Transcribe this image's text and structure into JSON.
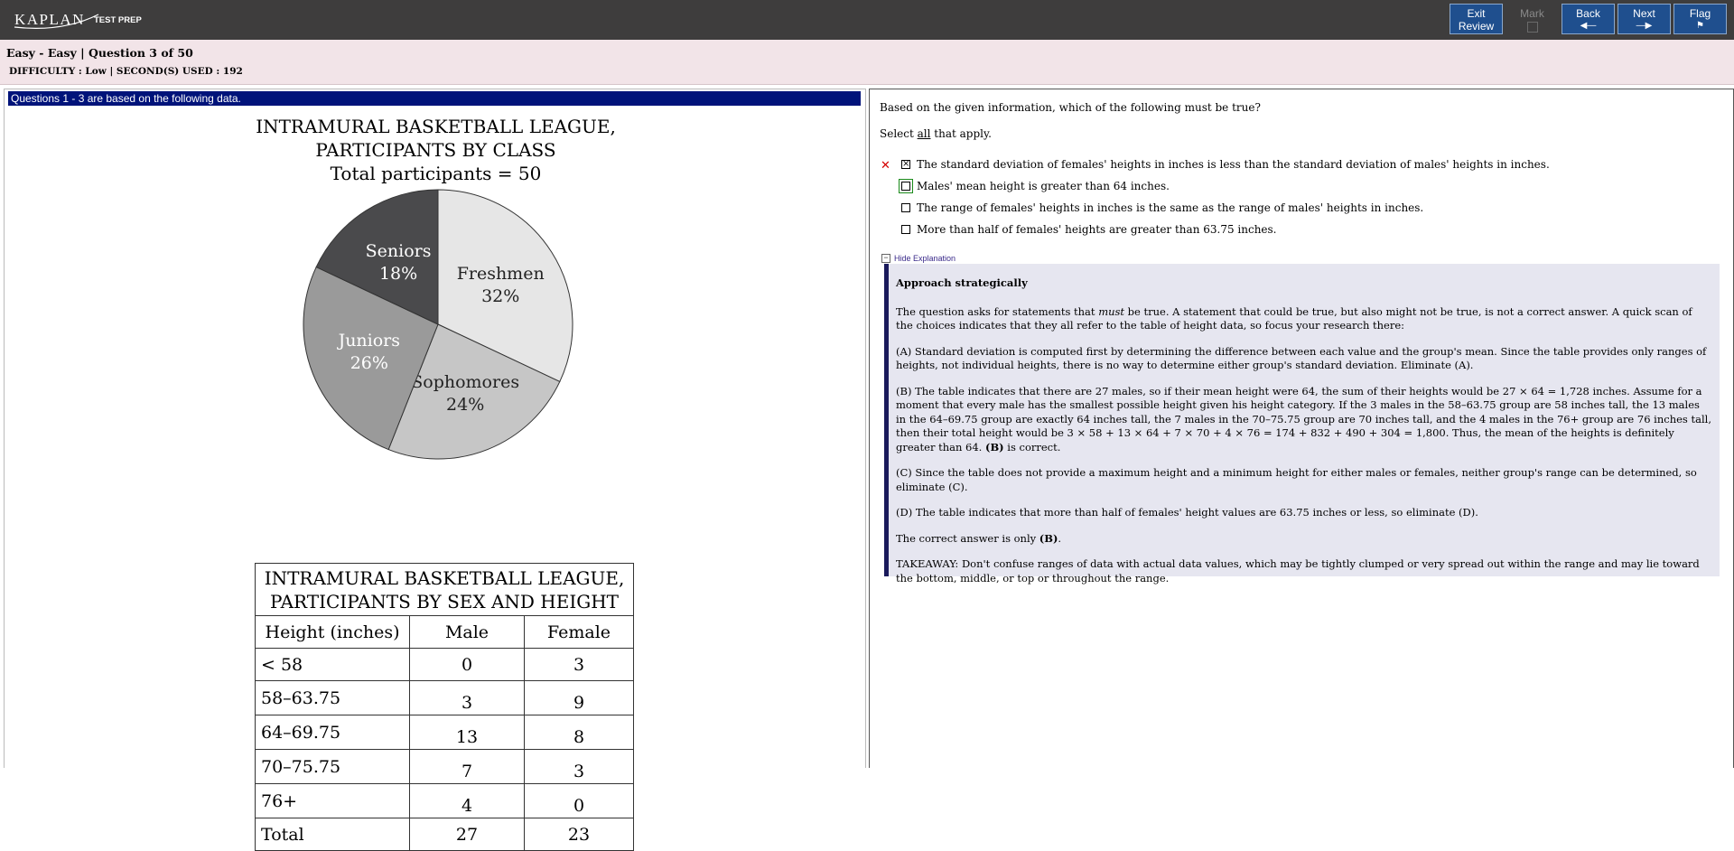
{
  "brand": {
    "name": "KAPLAN",
    "subtitle": "TEST PREP"
  },
  "toolbar": {
    "exit_label": "Exit",
    "exit_sub": "Review",
    "mark_label": "Mark",
    "back_label": "Back",
    "next_label": "Next",
    "flag_label": "Flag"
  },
  "info": {
    "question_line": "Easy - Easy | Question  3 of 50",
    "difficulty_line": "DIFFICULTY : Low | SECOND(S) USED : 192"
  },
  "passage": {
    "header": "Questions 1 - 3 are based on the following data.",
    "pie_title_1": "INTRAMURAL BASKETBALL LEAGUE,",
    "pie_title_2": "PARTICIPANTS BY CLASS",
    "pie_title_3": "Total participants = 50",
    "table_title_1": "INTRAMURAL BASKETBALL LEAGUE,",
    "table_title_2": "PARTICIPANTS BY SEX AND HEIGHT",
    "table_headers": [
      "Height (inches)",
      "Male",
      "Female"
    ],
    "table_rows": [
      [
        "< 58",
        "0",
        "3"
      ],
      [
        "58–63.75",
        "3",
        "9"
      ],
      [
        "64–69.75",
        "13",
        "8"
      ],
      [
        "70–75.75",
        "7",
        "3"
      ],
      [
        "76+",
        "4",
        "0"
      ],
      [
        "Total",
        "27",
        "23"
      ]
    ]
  },
  "chart_data": {
    "type": "pie",
    "title": "INTRAMURAL BASKETBALL LEAGUE, PARTICIPANTS BY CLASS",
    "subtitle": "Total participants = 50",
    "categories": [
      "Freshmen",
      "Sophomores",
      "Juniors",
      "Seniors"
    ],
    "values": [
      32,
      24,
      26,
      18
    ],
    "labels": [
      "32%",
      "24%",
      "26%",
      "18%"
    ],
    "colors": [
      "#e6e6e6",
      "#c6c6c6",
      "#9a9a9a",
      "#4a4a4c"
    ],
    "label_colors": [
      "#222222",
      "#222222",
      "#ffffff",
      "#ffffff"
    ]
  },
  "question": {
    "stem": "Based on the given information, which of the following must be true?",
    "select_prefix": "Select ",
    "select_underlined": "all",
    "select_suffix": " that apply.",
    "choices": [
      {
        "text": "The standard deviation of females' heights in inches is less than the standard deviation of males' heights in inches.",
        "checked": "×"
      },
      {
        "text": "Males' mean height is greater than 64 inches.",
        "checked": ""
      },
      {
        "text": "The range of females' heights in inches is the same as the range of males' heights in inches.",
        "checked": ""
      },
      {
        "text": "More than half of females' heights are greater than 63.75 inches.",
        "checked": ""
      }
    ],
    "wrong_mark": "✕"
  },
  "explanation": {
    "toggle_label": "Hide Explanation",
    "heading": "Approach strategically",
    "p1_a": "The question asks for statements that ",
    "p1_em": "must",
    "p1_b": " be true. A statement that could be true, but also might not be true, is not a correct answer. A quick scan of the choices indicates that they all refer to the table of height data, so focus your research there:",
    "p2": "(A) Standard deviation is computed first by determining the difference between each value and the group's mean. Since the table provides only ranges of heights, not individual heights, there is no way to determine either group's standard deviation. Eliminate (A).",
    "p3_a": "(B) The table indicates that there are 27 males, so if their mean height were 64, the sum of their heights would be 27 × 64 = 1,728 inches. Assume for a moment that every male has the smallest possible height given his height category. If the 3 males in the 58–63.75 group are 58 inches tall, the 13 males in the 64–69.75 group are exactly 64 inches tall, the 7 males in the 70–75.75 group are 70 inches tall, and the 4 males in the 76+ group are 76 inches tall, then their total height would be 3 × 58 + 13 × 64 + 7 × 70 + 4 × 76 = 174 + 832 + 490 + 304 = 1,800. Thus, the mean of the heights is definitely greater than 64. ",
    "p3_b": "(B)",
    "p3_c": " is correct.",
    "p4": "(C) Since the table does not provide a maximum height and a minimum height for either males or females, neither group's range can be determined, so eliminate (C).",
    "p5": "(D) The table indicates that more than half of females' height values are 63.75 inches or less, so eliminate (D).",
    "p6_a": "The correct answer is only ",
    "p6_b": "(B)",
    "p6_c": ".",
    "p7": "TAKEAWAY: Don't confuse ranges of data with actual data values, which may be tightly clumped or very spread out within the range and may lie toward the bottom, middle, or top or throughout the range."
  }
}
